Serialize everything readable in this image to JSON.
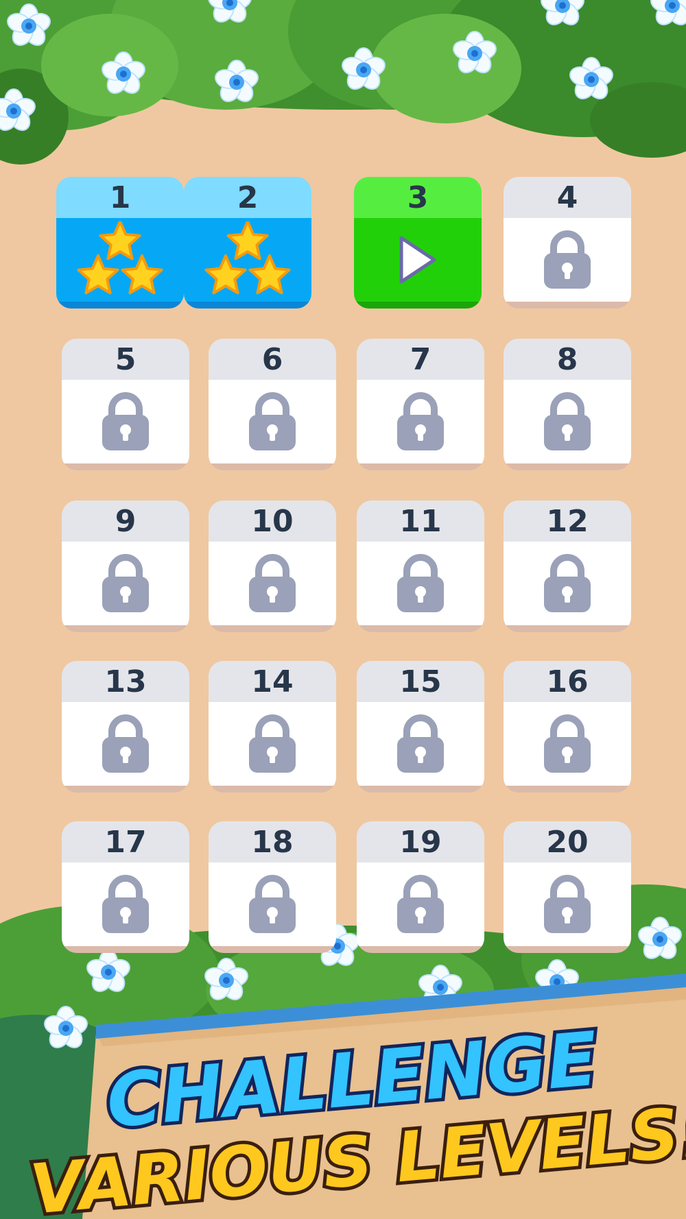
{
  "screen": "level-select",
  "levels": [
    {
      "number": "1",
      "state": "completed",
      "stars": 3
    },
    {
      "number": "2",
      "state": "completed",
      "stars": 3
    },
    {
      "number": "3",
      "state": "current"
    },
    {
      "number": "4",
      "state": "locked"
    },
    {
      "number": "5",
      "state": "locked"
    },
    {
      "number": "6",
      "state": "locked"
    },
    {
      "number": "7",
      "state": "locked"
    },
    {
      "number": "8",
      "state": "locked"
    },
    {
      "number": "9",
      "state": "locked"
    },
    {
      "number": "10",
      "state": "locked"
    },
    {
      "number": "11",
      "state": "locked"
    },
    {
      "number": "12",
      "state": "locked"
    },
    {
      "number": "13",
      "state": "locked"
    },
    {
      "number": "14",
      "state": "locked"
    },
    {
      "number": "15",
      "state": "locked"
    },
    {
      "number": "16",
      "state": "locked"
    },
    {
      "number": "17",
      "state": "locked"
    },
    {
      "number": "18",
      "state": "locked"
    },
    {
      "number": "19",
      "state": "locked"
    },
    {
      "number": "20",
      "state": "locked"
    }
  ],
  "banner": {
    "line1": "CHALLENGE",
    "line2": "VARIOUS LEVELS!"
  },
  "colors": {
    "background": "#efc8a1",
    "completed": "#06a8f5",
    "current": "#22d00a",
    "locked_icon": "#9aa1b8",
    "number_text": "#27364a",
    "star": "#ffd21f"
  },
  "icons": {
    "locked": "padlock-icon",
    "current": "play-icon",
    "completed": "star-icon"
  }
}
